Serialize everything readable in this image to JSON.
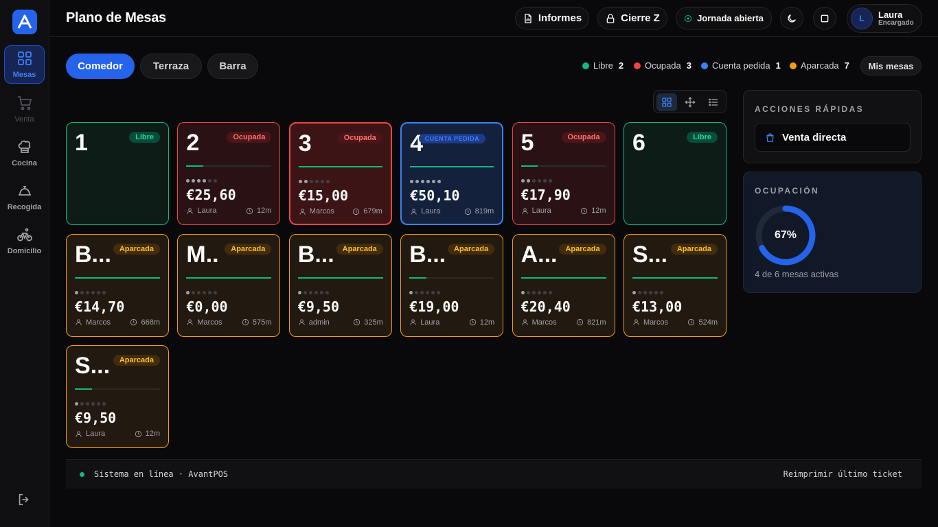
{
  "sidebar": {
    "logo_letter": "A",
    "items": [
      {
        "label": "Mesas",
        "icon": "grid-icon",
        "state": "active"
      },
      {
        "label": "Venta",
        "icon": "cart-icon",
        "state": "disabled"
      },
      {
        "label": "Cocina",
        "icon": "chef-hat-icon",
        "state": "normal"
      },
      {
        "label": "Recogida",
        "icon": "cloche-icon",
        "state": "normal"
      },
      {
        "label": "Domicilio",
        "icon": "bicycle-icon",
        "state": "normal"
      }
    ],
    "logout_icon": "logout-icon"
  },
  "header": {
    "title": "Plano de Mesas",
    "informes_label": "Informes",
    "cierre_label": "Cierre Z",
    "jornada_label": "Jornada abierta",
    "user": {
      "initial": "L",
      "name": "Laura",
      "role": "Encargado"
    }
  },
  "zones": [
    {
      "label": "Comedor",
      "active": true
    },
    {
      "label": "Terraza",
      "active": false
    },
    {
      "label": "Barra",
      "active": false
    }
  ],
  "legend": [
    {
      "label": "Libre",
      "count": "2",
      "color": "#10b981"
    },
    {
      "label": "Ocupada",
      "count": "3",
      "color": "#ef4444"
    },
    {
      "label": "Cuenta pedida",
      "count": "1",
      "color": "#3b82f6"
    },
    {
      "label": "Aparcada",
      "count": "7",
      "color": "#f59e0b"
    }
  ],
  "mis_mesas_label": "Mis mesas",
  "tables": [
    {
      "num": "1",
      "status": "libre",
      "badge": "Libre"
    },
    {
      "num": "2",
      "status": "ocupada",
      "badge": "Ocupada",
      "progress": 0.2,
      "dots": 4,
      "amount": "€25,60",
      "waiter": "Laura",
      "time": "12m"
    },
    {
      "num": "3",
      "status": "ocupada strong",
      "badge": "Ocupada",
      "progress": 1.0,
      "dots": 2,
      "amount": "€15,00",
      "waiter": "Marcos",
      "time": "679m"
    },
    {
      "num": "4",
      "status": "cuenta",
      "badge": "CUENTA PEDIDA",
      "progress": 1.0,
      "dots": 6,
      "amount": "€50,10",
      "waiter": "Laura",
      "time": "819m"
    },
    {
      "num": "5",
      "status": "ocupada",
      "badge": "Ocupada",
      "progress": 0.2,
      "dots": 2,
      "amount": "€17,90",
      "waiter": "Laura",
      "time": "12m"
    },
    {
      "num": "6",
      "status": "libre",
      "badge": "Libre"
    },
    {
      "num": "B...",
      "status": "aparcada",
      "badge": "Aparcada",
      "progress": 1.0,
      "dots": 1,
      "amount": "€14,70",
      "waiter": "Marcos",
      "time": "668m"
    },
    {
      "num": "M..",
      "status": "aparcada",
      "badge": "Aparcada",
      "progress": 1.0,
      "dots": 1,
      "amount": "€0,00",
      "waiter": "Marcos",
      "time": "575m"
    },
    {
      "num": "B...",
      "status": "aparcada",
      "badge": "Aparcada",
      "progress": 1.0,
      "dots": 1,
      "amount": "€9,50",
      "waiter": "admin",
      "time": "325m"
    },
    {
      "num": "B...",
      "status": "aparcada",
      "badge": "Aparcada",
      "progress": 0.2,
      "dots": 1,
      "amount": "€19,00",
      "waiter": "Laura",
      "time": "12m"
    },
    {
      "num": "A...",
      "status": "aparcada",
      "badge": "Aparcada",
      "progress": 1.0,
      "dots": 1,
      "amount": "€20,40",
      "waiter": "Marcos",
      "time": "821m"
    },
    {
      "num": "S...",
      "status": "aparcada",
      "badge": "Aparcada",
      "progress": 1.0,
      "dots": 1,
      "amount": "€13,00",
      "waiter": "Marcos",
      "time": "524m"
    },
    {
      "num": "S...",
      "status": "aparcada",
      "badge": "Aparcada",
      "progress": 0.2,
      "dots": 1,
      "amount": "€9,50",
      "waiter": "Laura",
      "time": "12m"
    }
  ],
  "quick_actions": {
    "title": "ACCIONES RÁPIDAS",
    "venta_label": "Venta directa"
  },
  "occupancy": {
    "title": "OCUPACIÓN",
    "percent": 67,
    "percent_label": "67%",
    "subtitle": "4 de 6 mesas activas"
  },
  "footer": {
    "status_text": "Sistema en línea · AvantPOS",
    "reprint_label": "Reimprimir último ticket"
  },
  "colors": {
    "accent": "#2563eb",
    "libre": "#10b981",
    "ocupada": "#ef4444",
    "cuenta": "#3b82f6",
    "aparcada": "#f59e0b"
  }
}
